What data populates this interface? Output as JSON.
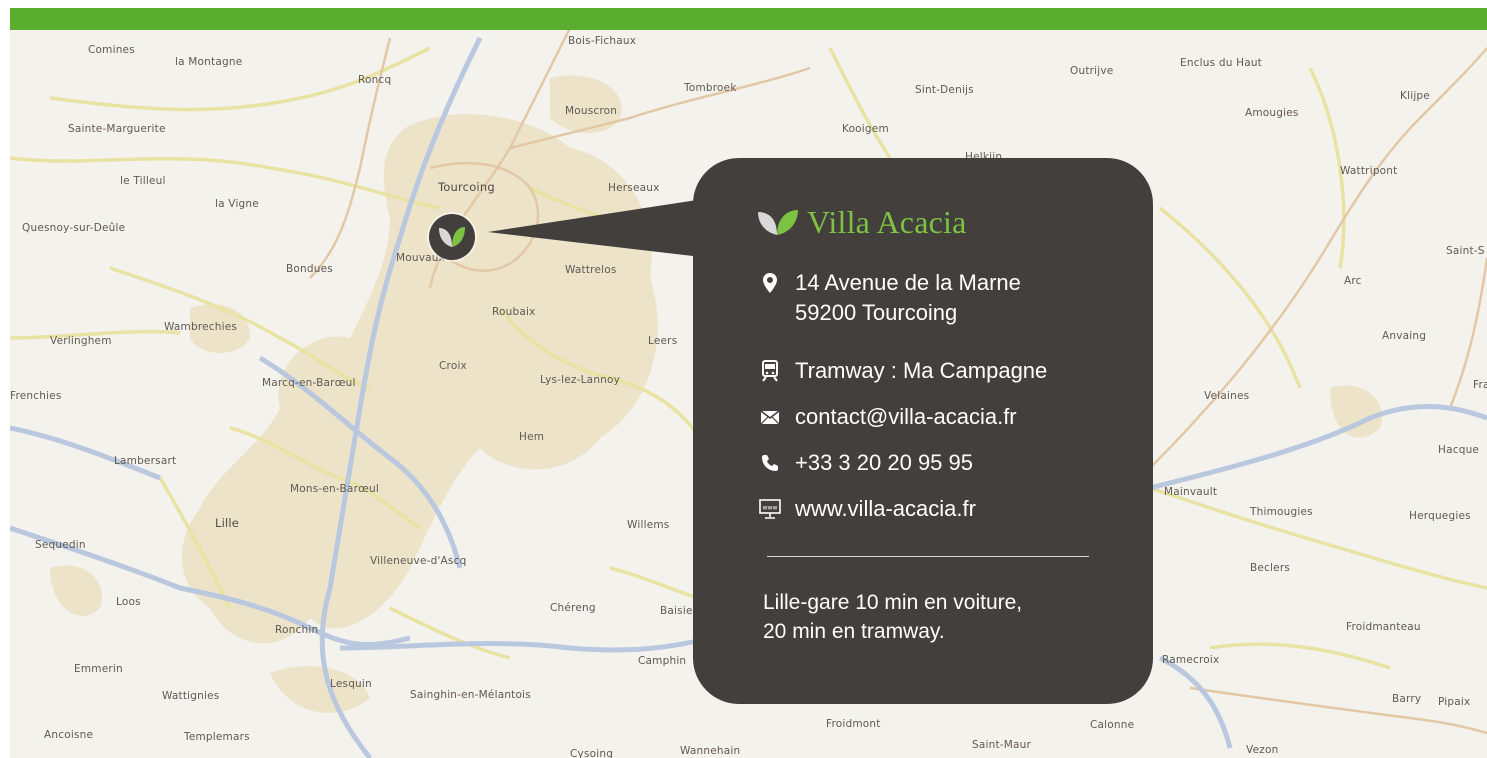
{
  "colors": {
    "topbar": "#5bad2f",
    "card_bg": "#433f3c",
    "brand_green": "#7dc242",
    "leaf_light": "#d8d8d8",
    "urban": "#ece3c9",
    "road_major": "#b9c8de",
    "road_primary": "#e3c8a6",
    "road_secondary": "#e8e3a2"
  },
  "map": {
    "places": [
      "Comines",
      "la Montagne",
      "Roncq",
      "Bois-Fichaux",
      "Tombroek",
      "Mouscron",
      "Outrijve",
      "Sint-Denijs",
      "Enclus du Haut",
      "Klijpe",
      "Amougies",
      "Sainte-Marguerite",
      "Kooigem",
      "Helkijn",
      "Wattripont",
      "le Tilleul",
      "Tourcoing",
      "Herseaux",
      "la Vigne",
      "Quesnoy-sur-Deûle",
      "Bondues",
      "Mouvaux",
      "Wattrelos",
      "Saint-S",
      "Arc",
      "Wambrechies",
      "Roubaix",
      "Anvaing",
      "Verlinghem",
      "Leers",
      "Croix",
      "Lys-lez-Lannoy",
      "Frenchies",
      "Marcq-en-Barœul",
      "Velaines",
      "Hem",
      "Hacque",
      "Lambersart",
      "Mons-en-Barœul",
      "Mainvault",
      "Lille",
      "Willems",
      "Thimougies",
      "Herquegies",
      "Sequedin",
      "Villeneuve-d'Ascq",
      "Beclers",
      "Loos",
      "Chéreng",
      "Baisieux",
      "Froidmanteau",
      "Ronchin",
      "Camphin",
      "Ramecroix",
      "Emmerin",
      "Lesquin",
      "Sainghin-en-Mélantois",
      "Barry",
      "Pipaix",
      "Wattignies",
      "Froidmont",
      "Calonne",
      "Ancoisne",
      "Templemars",
      "Saint-Maur",
      "Cysoing",
      "Wannehain",
      "Vezon",
      "Fra"
    ]
  },
  "marker": {
    "icon": "leaf-icon"
  },
  "card": {
    "brand": "Villa Acacia",
    "address_line1": "14 Avenue de la Marne",
    "address_line2": "59200 Tourcoing",
    "tram": "Tramway : Ma Campagne",
    "email": "contact@villa-acacia.fr",
    "phone": "+33 3 20 20 95 95",
    "website": "www.villa-acacia.fr",
    "www_icon_text": "www",
    "access_line1": "Lille-gare 10 min en voiture,",
    "access_line2": "20 min en tramway."
  }
}
